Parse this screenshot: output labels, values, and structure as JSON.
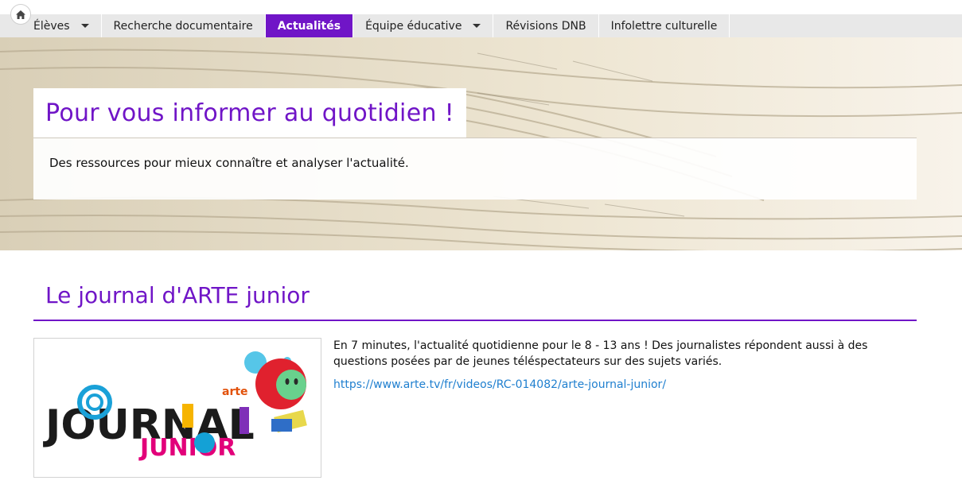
{
  "nav": {
    "home_icon": "home-icon",
    "items": [
      {
        "label": "Élèves",
        "has_dropdown": true,
        "active": false
      },
      {
        "label": "Recherche documentaire",
        "has_dropdown": false,
        "active": false
      },
      {
        "label": "Actualités",
        "has_dropdown": false,
        "active": true
      },
      {
        "label": "Équipe éducative",
        "has_dropdown": true,
        "active": false
      },
      {
        "label": "Révisions DNB",
        "has_dropdown": false,
        "active": false
      },
      {
        "label": "Infolettre culturelle",
        "has_dropdown": false,
        "active": false
      }
    ]
  },
  "hero": {
    "title": "Pour vous informer au quotidien !",
    "description": "Des ressources pour mieux connaître et analyser l'actualité."
  },
  "section": {
    "title": "Le journal d'ARTE junior",
    "text": "En 7 minutes, l'actualité quotidienne pour le 8 - 13 ans ! Des journalistes répondent aussi à des questions posées par de jeunes téléspectateurs sur des sujets variés.",
    "link": "https://www.arte.tv/fr/videos/RC-014082/arte-journal-junior/",
    "logo_text": {
      "main": "JOURNAL",
      "sub": "JUNIOR",
      "brand": "arte"
    }
  },
  "colors": {
    "accent": "#7015c7",
    "link": "#1f7fcf",
    "nav_bg": "#e8e8e8"
  }
}
